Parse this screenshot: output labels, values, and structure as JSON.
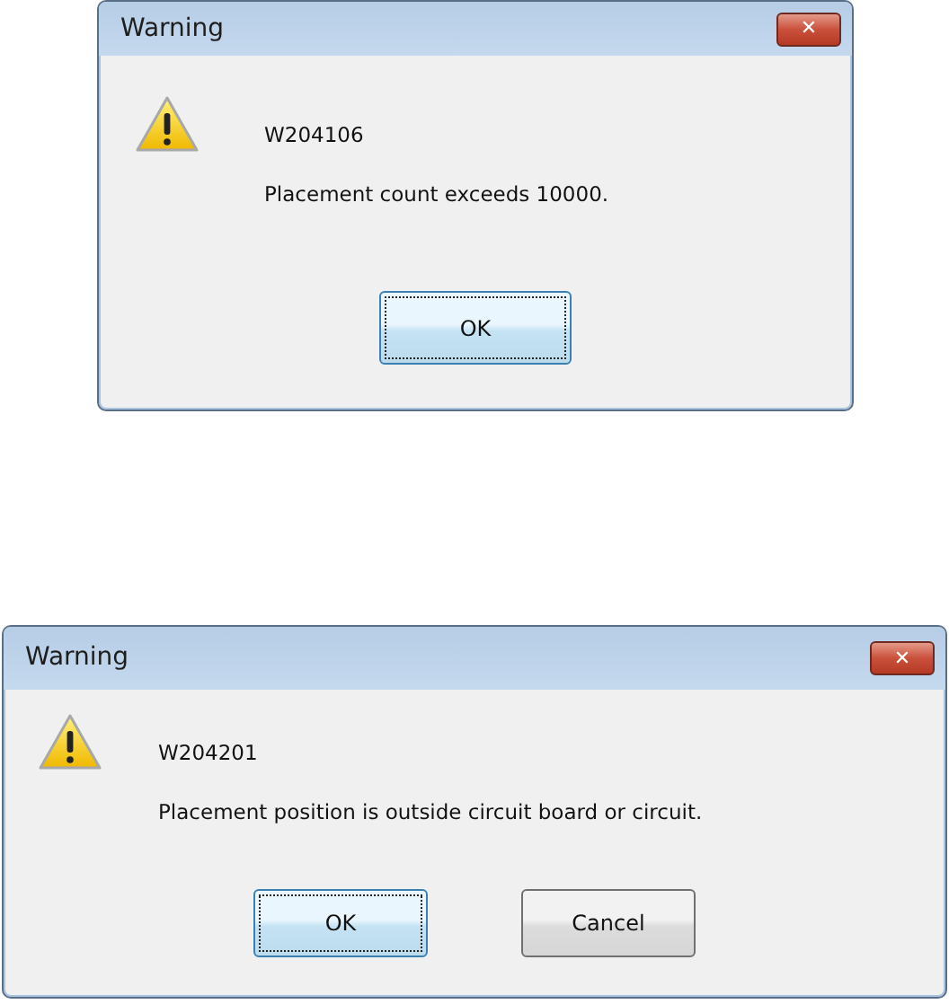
{
  "dialogs": [
    {
      "title": "Warning",
      "close": "✕",
      "code": "W204106",
      "message": "Placement count exceeds 10000.",
      "buttons": [
        {
          "label": "OK",
          "focused": true
        }
      ]
    },
    {
      "title": "Warning",
      "close": "✕",
      "code": "W204201",
      "message": "Placement position is outside circuit board or circuit.",
      "buttons": [
        {
          "label": "OK",
          "focused": true
        },
        {
          "label": "Cancel",
          "focused": false
        }
      ]
    }
  ]
}
